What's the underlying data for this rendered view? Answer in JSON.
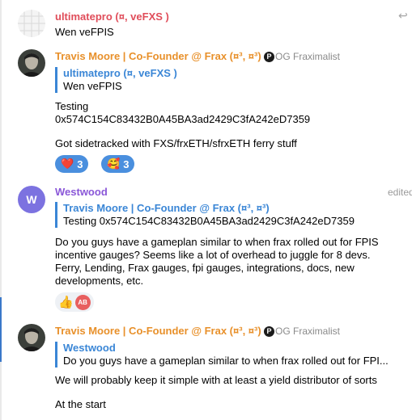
{
  "messages": [
    {
      "sender": "ultimatepro (¤, veFXS )",
      "text": "Wen veFPIS"
    },
    {
      "sender": "Travis Moore | Co-Founder @ Frax (¤³, ¤³)",
      "badge_icon": "P",
      "badge_title": "OG Fraximalist",
      "reply": {
        "name": "ultimatepro (¤, veFXS )",
        "text": "Wen veFPIS"
      },
      "lines": [
        "Testing",
        "0x574C154C83432B0A45BA3ad2429C3fA242eD7359",
        "",
        "Got sidetracked with FXS/frxETH/sfrxETH ferry stuff"
      ],
      "reactions": [
        {
          "icon": "heart",
          "emoji": "❤️",
          "count": "3"
        },
        {
          "icon": "smiling-face-with-hearts",
          "emoji": "🥰",
          "count": "3"
        }
      ]
    },
    {
      "sender": "Westwood",
      "avatar_letter": "W",
      "edited": "edited",
      "reply": {
        "name": "Travis Moore | Co-Founder @ Frax (¤³, ¤³)",
        "text": "Testing 0x574C154C83432B0A45BA3ad2429C3fA242eD7359"
      },
      "text": "Do you guys have a gameplan similar to when frax rolled out for FPIS incentive gauges? Seems like a lot of overhead to juggle for 8 devs. Ferry, Lending, Frax gauges, fpi gauges, integrations, docs, new developments, etc.",
      "reaction": {
        "icon": "thumbs-up",
        "emoji": "👍",
        "avatar_initials": "AB"
      }
    },
    {
      "sender": "Travis Moore | Co-Founder @ Frax (¤³, ¤³)",
      "badge_icon": "P",
      "badge_title": "OG Fraximalist",
      "reply": {
        "name": "Westwood",
        "text": "Do you guys have a gameplan similar to when frax rolled out for FPI..."
      },
      "lines": [
        "We will probably keep it simple with at least a yield distributor of sorts",
        "",
        "At the start"
      ]
    }
  ],
  "colors": {
    "accent": "#3a86d6",
    "reaction": "#4a8fde",
    "name_red": "#e04d5a",
    "name_orange": "#e8902a",
    "name_purple": "#8a57d8"
  }
}
